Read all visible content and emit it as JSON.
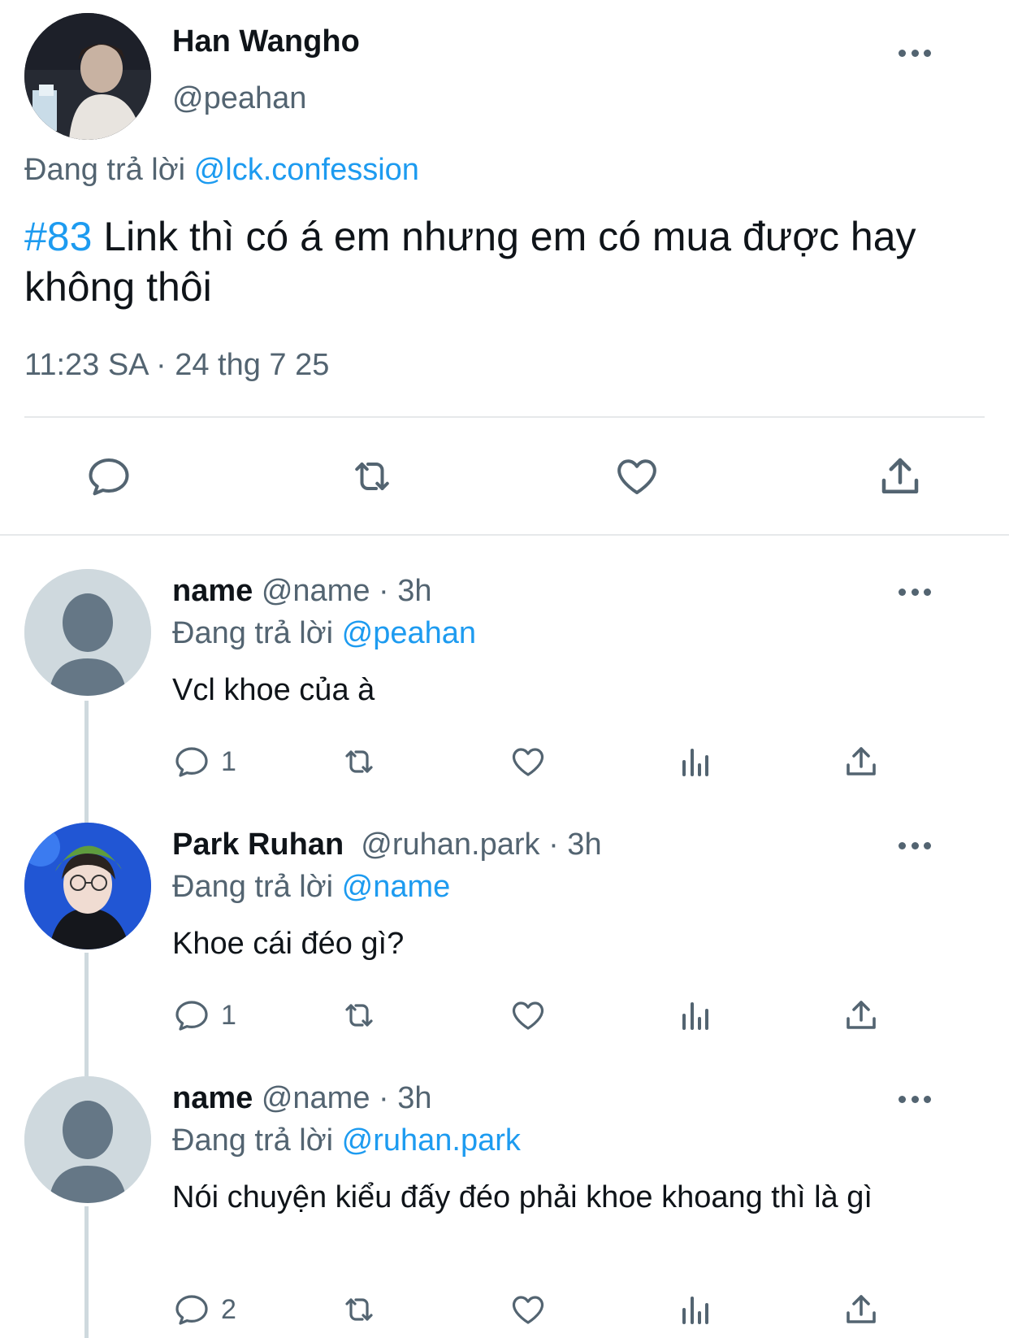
{
  "main_tweet": {
    "author_name": "Han Wangho",
    "author_handle": "@peahan",
    "reply_prefix": "Đang trả lời",
    "reply_to": "@lck.confession",
    "hashtag": "#83",
    "text": " Link thì có á em nhưng em có mua được hay không thôi",
    "timestamp": "11:23 SA · 24 thg 7 25",
    "actions": [
      "reply-icon",
      "retweet-icon",
      "like-icon",
      "share-icon"
    ]
  },
  "replies": [
    {
      "name": "name",
      "handle": "@name · 3h",
      "reply_prefix": "Đang trả lời",
      "reply_to": "@peahan",
      "text": "Vcl khoe của à",
      "reply_count": "1",
      "avatar": "default-avatar"
    },
    {
      "name": "Park Ruhan",
      "handle": "@ruhan.park · 3h",
      "reply_prefix": "Đang trả lời",
      "reply_to": "@name",
      "text": "Khoe cái đéo gì?",
      "reply_count": "1",
      "avatar": "photo-avatar"
    },
    {
      "name": "name",
      "handle": "@name · 3h",
      "reply_prefix": "Đang trả lời",
      "reply_to": "@ruhan.park",
      "text": "Nói chuyện kiểu đấy đéo phải khoe khoang thì là gì",
      "reply_count": "2",
      "avatar": "default-avatar"
    }
  ],
  "colors": {
    "link": "#1d9bf0",
    "secondary_text": "#536471",
    "primary_text": "#0f1419",
    "divider": "#e6e8ea",
    "default_avatar_bg": "#cfd9de",
    "default_avatar_fg": "#657786"
  }
}
